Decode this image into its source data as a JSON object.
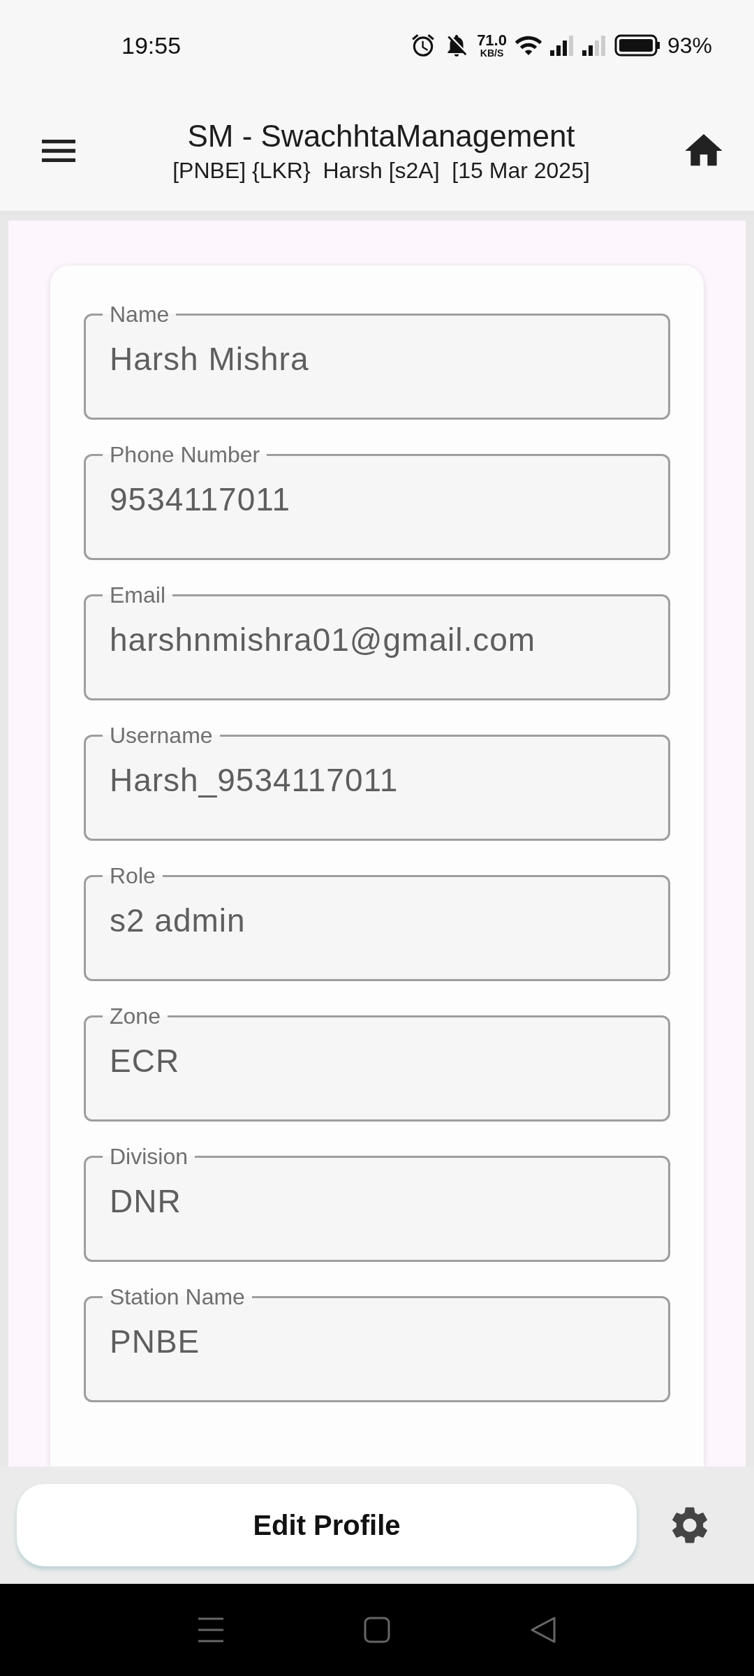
{
  "status_bar": {
    "time": "19:55",
    "speed_value": "71.0",
    "speed_unit": "KB/S",
    "battery": "93%"
  },
  "app_bar": {
    "title": "SM - SwachhtaManagement",
    "subtitle": "[PNBE] {LKR}  Harsh [s2A]  [15 Mar 2025]"
  },
  "fields": [
    {
      "label": "Name",
      "value": "Harsh Mishra"
    },
    {
      "label": "Phone Number",
      "value": "9534117011"
    },
    {
      "label": "Email",
      "value": "harshnmishra01@gmail.com"
    },
    {
      "label": "Username",
      "value": "Harsh_9534117011"
    },
    {
      "label": "Role",
      "value": "s2 admin"
    },
    {
      "label": "Zone",
      "value": "ECR"
    },
    {
      "label": "Division",
      "value": "DNR"
    },
    {
      "label": "Station Name",
      "value": "PNBE"
    }
  ],
  "edit_button": "Edit Profile"
}
